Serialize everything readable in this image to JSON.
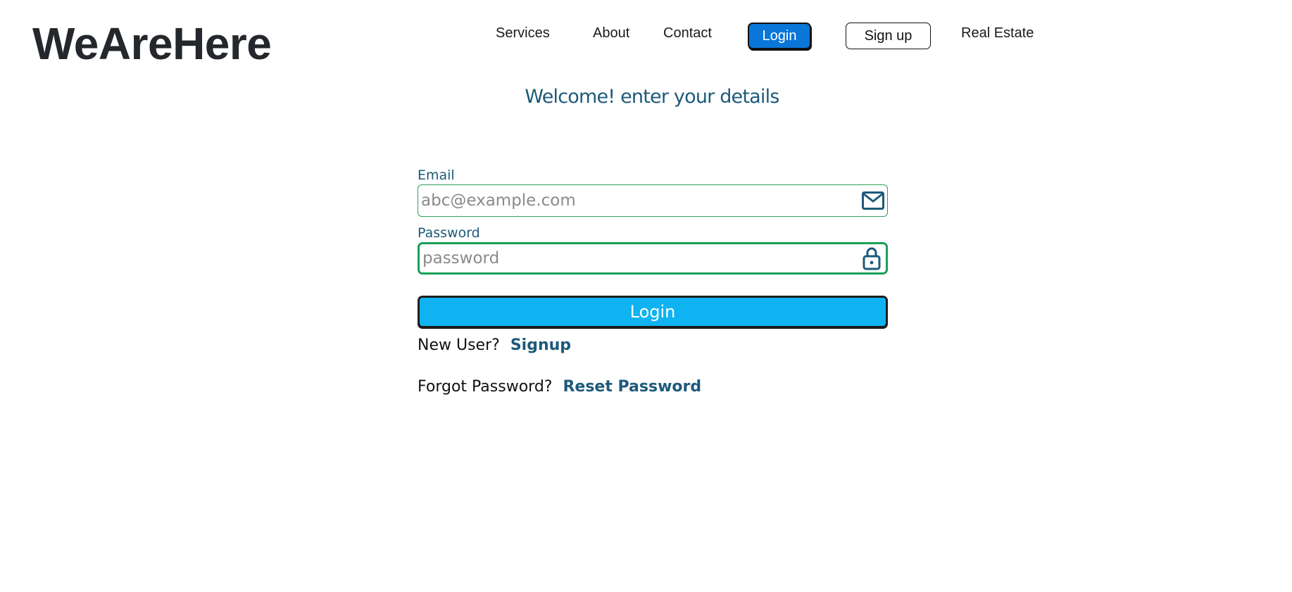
{
  "brand": "WeAreHere",
  "nav": {
    "services": "Services",
    "about": "About",
    "contact": "Contact",
    "login": "Login",
    "signup": "Sign up",
    "real_estate": "Real Estate"
  },
  "heading": "Welcome! enter your details",
  "form": {
    "email_label": "Email",
    "email_placeholder": "abc@example.com",
    "email_icon": "envelope-icon",
    "password_label": "Password",
    "password_placeholder": "password",
    "password_icon": "lock-icon",
    "login_button": "Login",
    "new_user_text": "New User?",
    "signup_link": "Signup",
    "forgot_text": "Forgot Password?",
    "reset_link": "Reset Password"
  },
  "colors": {
    "accent": "#1d5a7a",
    "nav_login_bg": "#0a76d8",
    "login_button_bg": "#0fb3f2",
    "input_border": "#19a058"
  }
}
